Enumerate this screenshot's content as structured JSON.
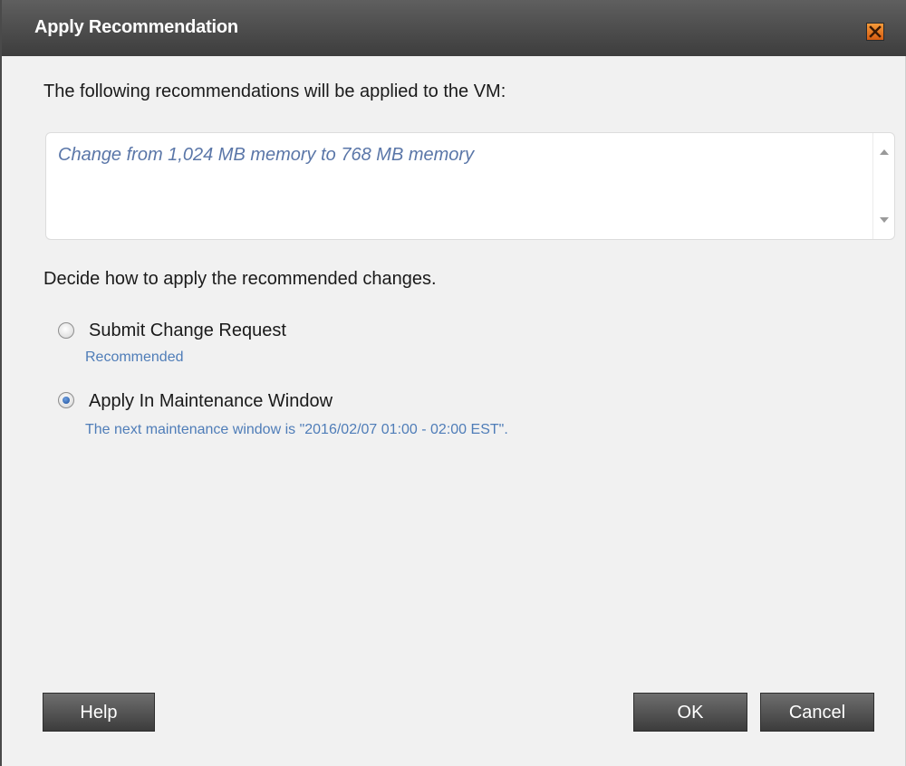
{
  "dialog": {
    "title": "Apply Recommendation",
    "intro": "The following recommendations will be applied to the VM:",
    "recommendation": "Change from 1,024 MB memory to 768 MB memory",
    "decide": "Decide how to apply the recommended changes.",
    "options": [
      {
        "label": "Submit Change Request",
        "sub": "Recommended",
        "selected": false
      },
      {
        "label": "Apply In Maintenance Window",
        "sub": "The next maintenance window is \"2016/02/07 01:00 - 02:00 EST\".",
        "selected": true
      }
    ],
    "buttons": {
      "help": "Help",
      "ok": "OK",
      "cancel": "Cancel"
    }
  },
  "icons": {
    "close": "close-icon",
    "scroll_up": "chevron-up-icon",
    "scroll_down": "chevron-down-icon"
  },
  "colors": {
    "titlebar": "#4a4a4a",
    "accent_text": "#4f7db8",
    "close_orange": "#e07020"
  }
}
